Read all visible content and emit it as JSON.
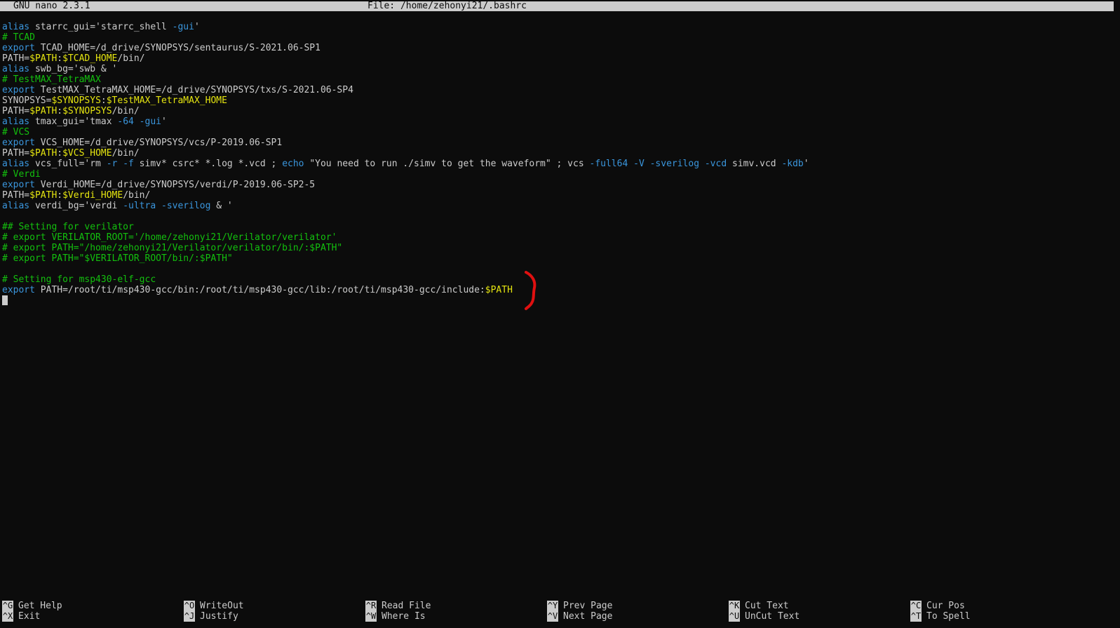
{
  "titlebar": {
    "version": "GNU nano 2.3.1",
    "file": "File: /home/zehonyi21/.bashrc"
  },
  "lines": [
    [
      {
        "t": "alias",
        "c": "kw"
      },
      {
        "t": " starrc_gui='starrc_shell ",
        "c": "normal"
      },
      {
        "t": "-gui",
        "c": "flag"
      },
      {
        "t": "'",
        "c": "normal"
      }
    ],
    [
      {
        "t": "# TCAD",
        "c": "comment"
      }
    ],
    [
      {
        "t": "export",
        "c": "kw"
      },
      {
        "t": " TCAD_HOME=/d_drive/SYNOPSYS/sentaurus/S-2021.06-SP1",
        "c": "normal"
      }
    ],
    [
      {
        "t": "PATH=",
        "c": "normal"
      },
      {
        "t": "$PATH",
        "c": "var"
      },
      {
        "t": ":",
        "c": "normal"
      },
      {
        "t": "$TCAD_HOME",
        "c": "var"
      },
      {
        "t": "/bin/",
        "c": "normal"
      }
    ],
    [
      {
        "t": "alias",
        "c": "kw"
      },
      {
        "t": " swb_bg='swb & '",
        "c": "normal"
      }
    ],
    [
      {
        "t": "# TestMAX_TetraMAX",
        "c": "comment"
      }
    ],
    [
      {
        "t": "export",
        "c": "kw"
      },
      {
        "t": " TestMAX_TetraMAX_HOME=/d_drive/SYNOPSYS/txs/S-2021.06-SP4",
        "c": "normal"
      }
    ],
    [
      {
        "t": "SYNOPSYS=",
        "c": "normal"
      },
      {
        "t": "$SYNOPSYS",
        "c": "var"
      },
      {
        "t": ":",
        "c": "normal"
      },
      {
        "t": "$TestMAX_TetraMAX_HOME",
        "c": "var"
      }
    ],
    [
      {
        "t": "PATH=",
        "c": "normal"
      },
      {
        "t": "$PATH",
        "c": "var"
      },
      {
        "t": ":",
        "c": "normal"
      },
      {
        "t": "$SYNOPSYS",
        "c": "var"
      },
      {
        "t": "/bin/",
        "c": "normal"
      }
    ],
    [
      {
        "t": "alias",
        "c": "kw"
      },
      {
        "t": " tmax_gui='tmax ",
        "c": "normal"
      },
      {
        "t": "-64 -gui",
        "c": "flag"
      },
      {
        "t": "'",
        "c": "normal"
      }
    ],
    [
      {
        "t": "# VCS",
        "c": "comment"
      }
    ],
    [
      {
        "t": "export",
        "c": "kw"
      },
      {
        "t": " VCS_HOME=/d_drive/SYNOPSYS/vcs/P-2019.06-SP1",
        "c": "normal"
      }
    ],
    [
      {
        "t": "PATH=",
        "c": "normal"
      },
      {
        "t": "$PATH",
        "c": "var"
      },
      {
        "t": ":",
        "c": "normal"
      },
      {
        "t": "$VCS_HOME",
        "c": "var"
      },
      {
        "t": "/bin/",
        "c": "normal"
      }
    ],
    [
      {
        "t": "alias",
        "c": "kw"
      },
      {
        "t": " vcs_full='rm ",
        "c": "normal"
      },
      {
        "t": "-r -f",
        "c": "flag"
      },
      {
        "t": " simv* csrc* *.log *.vcd ; ",
        "c": "normal"
      },
      {
        "t": "echo",
        "c": "kw"
      },
      {
        "t": " \"You need to run ./simv to get the waveform\" ; vcs ",
        "c": "normal"
      },
      {
        "t": "-full64 -V -sverilog -vcd",
        "c": "flag"
      },
      {
        "t": " simv.vcd ",
        "c": "normal"
      },
      {
        "t": "-kdb",
        "c": "flag"
      },
      {
        "t": "'",
        "c": "normal"
      }
    ],
    [
      {
        "t": "# Verdi",
        "c": "comment"
      }
    ],
    [
      {
        "t": "export",
        "c": "kw"
      },
      {
        "t": " Verdi_HOME=/d_drive/SYNOPSYS/verdi/P-2019.06-SP2-5",
        "c": "normal"
      }
    ],
    [
      {
        "t": "PATH=",
        "c": "normal"
      },
      {
        "t": "$PATH",
        "c": "var"
      },
      {
        "t": ":",
        "c": "normal"
      },
      {
        "t": "$Verdi_HOME",
        "c": "var"
      },
      {
        "t": "/bin/",
        "c": "normal"
      }
    ],
    [
      {
        "t": "alias",
        "c": "kw"
      },
      {
        "t": " verdi_bg='verdi ",
        "c": "normal"
      },
      {
        "t": "-ultra -sverilog",
        "c": "flag"
      },
      {
        "t": " & '",
        "c": "normal"
      }
    ],
    [],
    [
      {
        "t": "## Setting for verilator",
        "c": "comment"
      }
    ],
    [
      {
        "t": "# export VERILATOR_ROOT='/home/zehonyi21/Verilator/verilator'",
        "c": "comment"
      }
    ],
    [
      {
        "t": "# export PATH=\"/home/zehonyi21/Verilator/verilator/bin/:$PATH\"",
        "c": "comment"
      }
    ],
    [
      {
        "t": "# export PATH=\"$VERILATOR_ROOT/bin/:$PATH\"",
        "c": "comment"
      }
    ],
    [],
    [
      {
        "t": "# Setting for msp430-elf-gcc",
        "c": "comment"
      }
    ],
    [
      {
        "t": "export",
        "c": "kw"
      },
      {
        "t": " PATH=/root/ti/msp430-gcc/bin:/root/ti/msp430-gcc/lib:/root/ti/msp430-gcc/include:",
        "c": "normal"
      },
      {
        "t": "$PATH",
        "c": "var"
      }
    ],
    []
  ],
  "annotation_color": "#e01010",
  "shortcuts": [
    [
      {
        "key": "^G",
        "label": "Get Help"
      },
      {
        "key": "^X",
        "label": "Exit"
      }
    ],
    [
      {
        "key": "^O",
        "label": "WriteOut"
      },
      {
        "key": "^J",
        "label": "Justify"
      }
    ],
    [
      {
        "key": "^R",
        "label": "Read File"
      },
      {
        "key": "^W",
        "label": "Where Is"
      }
    ],
    [
      {
        "key": "^Y",
        "label": "Prev Page"
      },
      {
        "key": "^V",
        "label": "Next Page"
      }
    ],
    [
      {
        "key": "^K",
        "label": "Cut Text"
      },
      {
        "key": "^U",
        "label": "UnCut Text"
      }
    ],
    [
      {
        "key": "^C",
        "label": "Cur Pos"
      },
      {
        "key": "^T",
        "label": "To Spell"
      }
    ]
  ]
}
